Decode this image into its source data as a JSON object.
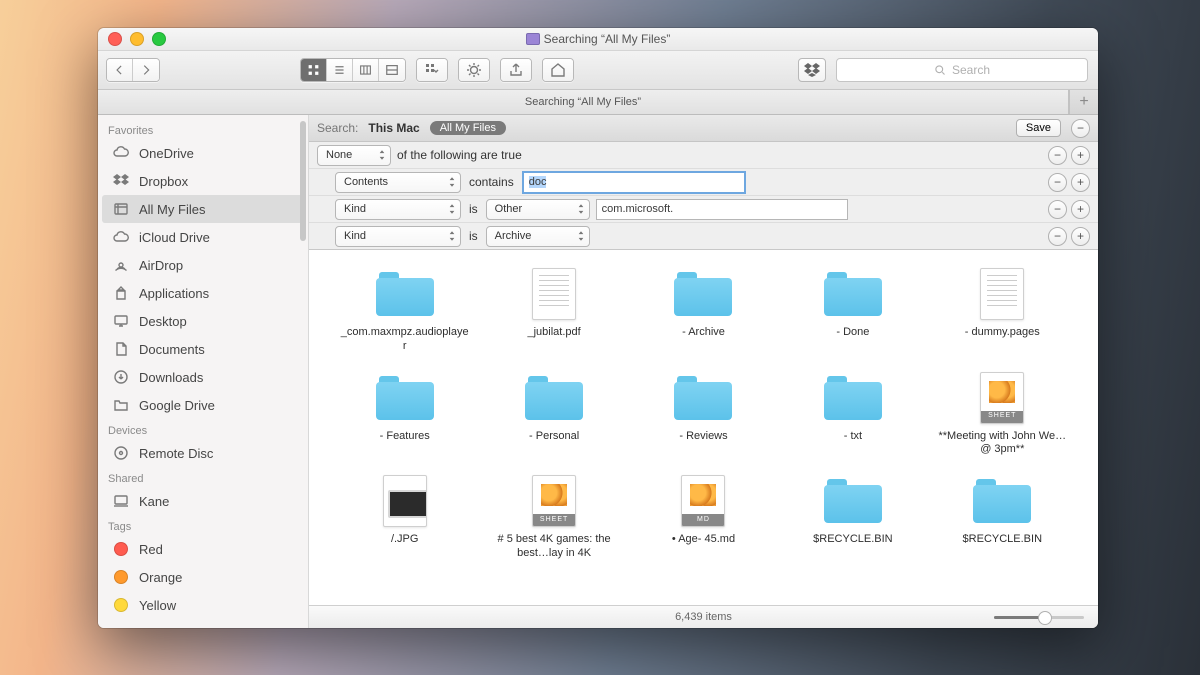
{
  "window_title": "Searching “All My Files”",
  "tab_title": "Searching “All My Files”",
  "toolbar": {
    "search_placeholder": "Search"
  },
  "searchbar": {
    "label": "Search:",
    "scope_this_mac": "This Mac",
    "scope_all_files": "All My Files",
    "save": "Save"
  },
  "rules": [
    {
      "indent": 0,
      "left": "None",
      "text": "of the following are true"
    },
    {
      "indent": 1,
      "left": "Contents",
      "mid": "contains",
      "input": "doc",
      "focused": true
    },
    {
      "indent": 1,
      "left": "Kind",
      "mid": "is",
      "right": "Other",
      "input": "com.microsoft."
    },
    {
      "indent": 1,
      "left": "Kind",
      "mid": "is",
      "right": "Archive"
    }
  ],
  "sidebar": {
    "sections": [
      {
        "header": "Favorites",
        "items": [
          {
            "icon": "cloud-sync",
            "label": "OneDrive"
          },
          {
            "icon": "dropbox",
            "label": "Dropbox"
          },
          {
            "icon": "all-files",
            "label": "All My Files",
            "selected": true
          },
          {
            "icon": "cloud",
            "label": "iCloud Drive"
          },
          {
            "icon": "airdrop",
            "label": "AirDrop"
          },
          {
            "icon": "apps",
            "label": "Applications"
          },
          {
            "icon": "desktop",
            "label": "Desktop"
          },
          {
            "icon": "docs",
            "label": "Documents"
          },
          {
            "icon": "downloads",
            "label": "Downloads"
          },
          {
            "icon": "folder",
            "label": "Google Drive"
          }
        ]
      },
      {
        "header": "Devices",
        "items": [
          {
            "icon": "disc",
            "label": "Remote Disc"
          }
        ]
      },
      {
        "header": "Shared",
        "items": [
          {
            "icon": "computer",
            "label": "Kane"
          }
        ]
      },
      {
        "header": "Tags",
        "items": [
          {
            "icon": "tag",
            "label": "Red",
            "color": "#ff5b4f"
          },
          {
            "icon": "tag",
            "label": "Orange",
            "color": "#ff9a2d"
          },
          {
            "icon": "tag",
            "label": "Yellow",
            "color": "#ffd93b"
          }
        ]
      }
    ]
  },
  "files": [
    {
      "kind": "folder",
      "name": "_com.maxmpz.audioplayer"
    },
    {
      "kind": "doc",
      "name": "_jubilat.pdf"
    },
    {
      "kind": "folder",
      "name": "- Archive"
    },
    {
      "kind": "folder",
      "name": "- Done"
    },
    {
      "kind": "doc",
      "name": "- dummy.pages"
    },
    {
      "kind": "folder",
      "name": "- Features"
    },
    {
      "kind": "folder",
      "name": "- Personal"
    },
    {
      "kind": "folder",
      "name": "- Reviews"
    },
    {
      "kind": "folder",
      "name": "- txt"
    },
    {
      "kind": "sheet",
      "name": "**Meeting with John We…@ 3pm**"
    },
    {
      "kind": "jpg",
      "name": "/.JPG"
    },
    {
      "kind": "sheet",
      "name": "# 5 best 4K games: the best…lay in 4K"
    },
    {
      "kind": "md",
      "name": "• Age- 45.md"
    },
    {
      "kind": "folder",
      "name": "$RECYCLE.BIN"
    },
    {
      "kind": "folder",
      "name": "$RECYCLE.BIN"
    }
  ],
  "status": {
    "count": "6,439 items"
  }
}
